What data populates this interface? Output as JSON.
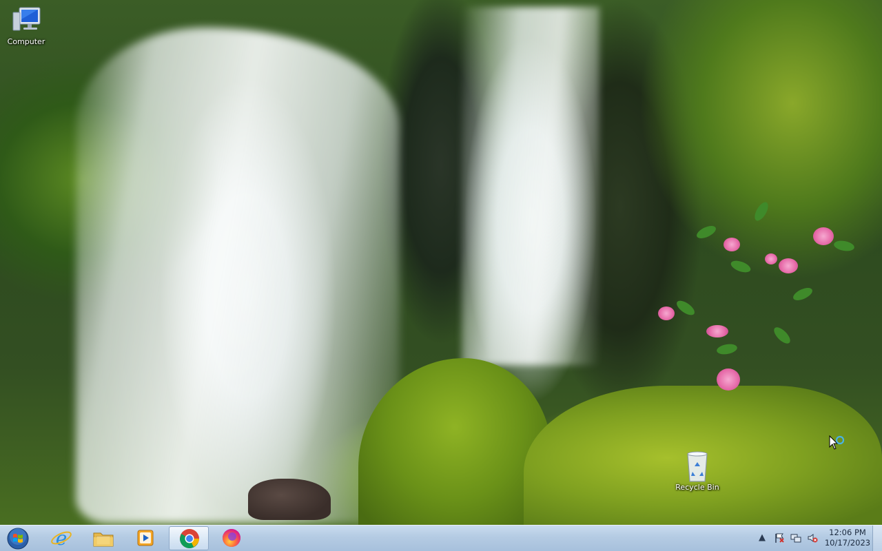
{
  "desktop": {
    "icons": {
      "computer": {
        "label": "Computer"
      },
      "recycle_bin": {
        "label": "Recycle Bin"
      }
    }
  },
  "taskbar": {
    "start_button": {
      "icon": "windows-orb-icon"
    },
    "pinned": [
      {
        "name": "Internet Explorer",
        "icon": "internet-explorer-icon"
      },
      {
        "name": "Windows Explorer",
        "icon": "folder-icon"
      },
      {
        "name": "Windows Media Player",
        "icon": "media-player-icon"
      },
      {
        "name": "Google Chrome",
        "icon": "chrome-icon",
        "active": true
      },
      {
        "name": "Firefox",
        "icon": "firefox-icon"
      }
    ],
    "tray": {
      "icons": [
        "show-hidden-icons-icon",
        "action-center-flag-icon",
        "network-icon",
        "volume-muted-icon"
      ],
      "clock": {
        "time": "12:06 PM",
        "date": "10/17/2023"
      }
    }
  },
  "colors": {
    "taskbar": "#b4cbe3",
    "clock_text": "#1b2a3f"
  }
}
